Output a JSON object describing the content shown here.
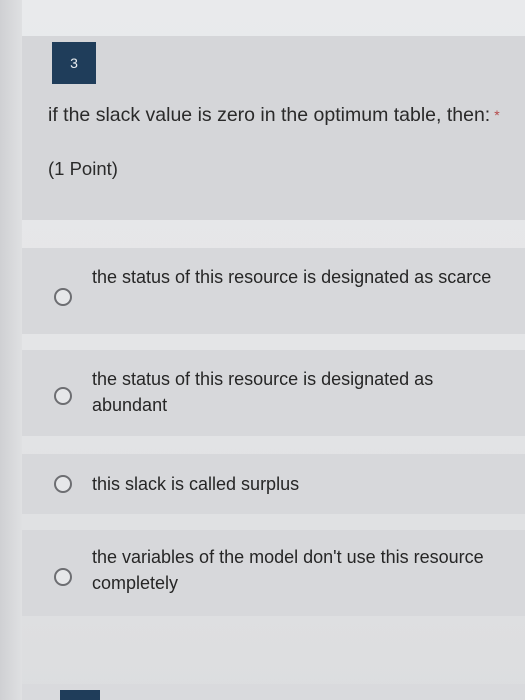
{
  "question": {
    "number": "3",
    "text": "if the slack value is zero in the optimum table, then:",
    "required_mark": "*",
    "points": "(1 Point)"
  },
  "options": [
    {
      "label": "the status of this resource is designated as scarce"
    },
    {
      "label": "the status of this resource is designated as abundant"
    },
    {
      "label": "this slack is called surplus"
    },
    {
      "label": "the variables of the model don't use this resource completely"
    }
  ]
}
